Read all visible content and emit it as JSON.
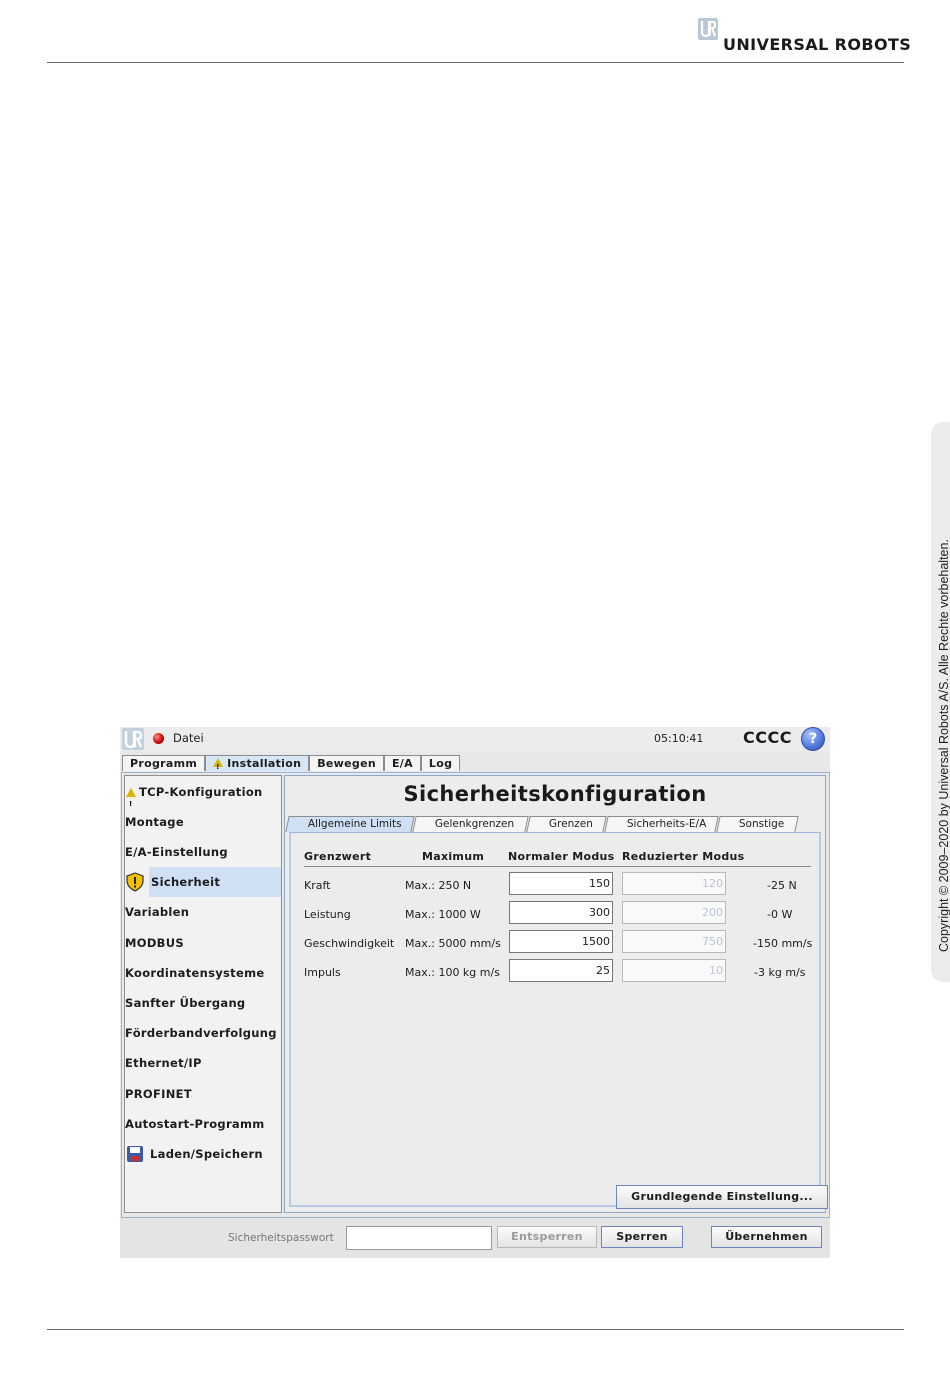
{
  "page": {
    "brand": "UNIVERSAL ROBOTS",
    "copyright": "Copyright © 2009–2020 by Universal Robots A/S. Alle Rechte vorbehalten."
  },
  "topbar": {
    "file_menu": "Datei",
    "clock": "05:10:41",
    "robot_name": "CCCC",
    "help": "?"
  },
  "main_tabs": [
    {
      "label": "Programm",
      "active": false
    },
    {
      "label": "Installation",
      "active": true,
      "warning": true
    },
    {
      "label": "Bewegen",
      "active": false
    },
    {
      "label": "E/A",
      "active": false
    },
    {
      "label": "Log",
      "active": false
    }
  ],
  "sidebar": {
    "items": [
      {
        "label": "TCP-Konfiguration",
        "icon": "warning-icon"
      },
      {
        "label": "Montage"
      },
      {
        "label": "E/A-Einstellung"
      },
      {
        "label": "Sicherheit",
        "icon": "shield-icon",
        "active": true
      },
      {
        "label": "Variablen"
      },
      {
        "label": "MODBUS"
      },
      {
        "label": "Koordinatensysteme"
      },
      {
        "label": "Sanfter Übergang"
      },
      {
        "label": "Förderbandverfolgung"
      },
      {
        "label": "Ethernet/IP"
      },
      {
        "label": "PROFINET"
      },
      {
        "label": "Autostart-Programm"
      },
      {
        "label": "Laden/Speichern",
        "icon": "floppy-icon"
      }
    ]
  },
  "panel": {
    "title": "Sicherheitskonfiguration",
    "subtabs": [
      {
        "label": "Allgemeine Limits",
        "active": true
      },
      {
        "label": "Gelenkgrenzen"
      },
      {
        "label": "Grenzen"
      },
      {
        "label": "Sicherheits-E/A"
      },
      {
        "label": "Sonstige"
      }
    ],
    "table": {
      "headers": [
        "Grenzwert",
        "Maximum",
        "Normaler Modus",
        "Reduzierter Modus"
      ],
      "rows": [
        {
          "name": "Kraft",
          "max": "Max.: 250 N",
          "normal": "150",
          "reduced": "120",
          "diff": "-25 N"
        },
        {
          "name": "Leistung",
          "max": "Max.: 1000 W",
          "normal": "300",
          "reduced": "200",
          "diff": "-0 W"
        },
        {
          "name": "Geschwindigkeit",
          "max": "Max.: 5000 mm/s",
          "normal": "1500",
          "reduced": "750",
          "diff": "-150 mm/s"
        },
        {
          "name": "Impuls",
          "max": "Max.: 100 kg m/s",
          "normal": "25",
          "reduced": "10",
          "diff": "-3 kg m/s"
        }
      ]
    },
    "default_button": "Grundlegende Einstellung..."
  },
  "bottombar": {
    "password_label": "Sicherheitspasswort",
    "password_value": "",
    "unlock": "Entsperren",
    "lock": "Sperren",
    "apply": "Übernehmen"
  },
  "colors": {
    "active_tab": "#d7e6f7",
    "active_side": "#cfdff4",
    "warning": "#d8b300",
    "status_dot": "#c40000"
  }
}
